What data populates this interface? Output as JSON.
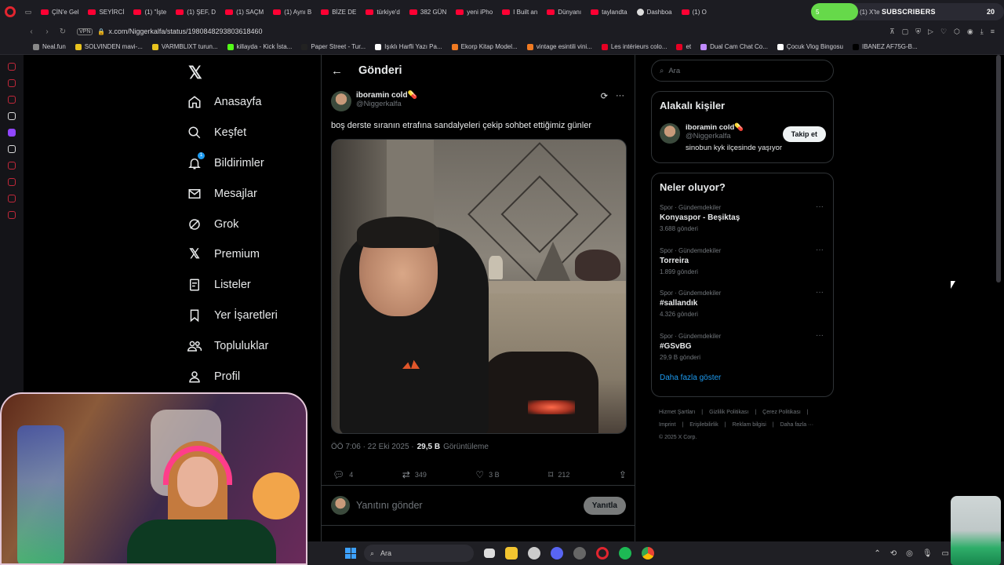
{
  "browser": {
    "tabs": [
      {
        "label": "ÇİN'e Gel"
      },
      {
        "label": "SEYİRCİ"
      },
      {
        "label": "(1) \"İşte"
      },
      {
        "label": "(1) ŞEF, D"
      },
      {
        "label": "(1) SAÇM"
      },
      {
        "label": "(1) Aynı B"
      },
      {
        "label": "BİZE DE"
      },
      {
        "label": "türkiye'd"
      },
      {
        "label": "382 GÜN"
      },
      {
        "label": "yeni iPho"
      },
      {
        "label": "I Built an"
      },
      {
        "label": "Dünyanı"
      },
      {
        "label": "taylandta"
      },
      {
        "label": "Dashboa"
      },
      {
        "label": "(1) O"
      }
    ],
    "subscriber_widget": {
      "label": "SUBSCRIBERS",
      "count": "20",
      "badge": "5",
      "extra_tab": "(1) X'te"
    },
    "url": "x.com/Niggerkalfa/status/1980848293803618460",
    "vpn_label": "VPN",
    "bookmarks": [
      "Neal.fun",
      "SOLVINDEN mavi-...",
      "VARMBLIXT turun...",
      "killayda - Kick İsta...",
      "Paper Street - Tur...",
      "Işıklı Harfli Yazı Pa...",
      "Ekorp Kitap Model...",
      "vintage esintili vini...",
      "Les intérieurs colo...",
      "et",
      "Dual Cam Chat Co...",
      "Çocuk Vlog Bingosu",
      "IBANEZ AF75G-B..."
    ]
  },
  "nav": {
    "items": [
      {
        "label": "Anasayfa",
        "icon": "home-icon"
      },
      {
        "label": "Keşfet",
        "icon": "search-icon"
      },
      {
        "label": "Bildirimler",
        "icon": "bell-icon",
        "badge": "1"
      },
      {
        "label": "Mesajlar",
        "icon": "mail-icon"
      },
      {
        "label": "Grok",
        "icon": "grok-icon"
      },
      {
        "label": "Premium",
        "icon": "x-icon"
      },
      {
        "label": "Listeler",
        "icon": "list-icon"
      },
      {
        "label": "Yer İşaretleri",
        "icon": "bookmark-icon"
      },
      {
        "label": "Topluluklar",
        "icon": "communities-icon"
      },
      {
        "label": "Profil",
        "icon": "person-icon"
      }
    ]
  },
  "main": {
    "title": "Gönderi",
    "post": {
      "name": "iboramin cold💊",
      "handle": "@Niggerkalfa",
      "text": "boş derste sıranın etrafına sandalyeleri çekip sohbet ettiğimiz günler",
      "timestamp": "ÖÖ 7:06 · 22 Eki 2025 ·",
      "views_count": "29,5 B",
      "views_label": "Görüntüleme",
      "replies": "4",
      "reposts": "349",
      "likes": "3 B",
      "bookmarks": "212"
    },
    "reply": {
      "placeholder": "Yanıtını gönder",
      "button": "Yanıtla"
    }
  },
  "right": {
    "search_placeholder": "Ara",
    "related": {
      "title": "Alakalı kişiler",
      "name": "iboramin cold💊",
      "handle": "@Niggerkalfa",
      "bio": "sinobun kyk ilçesinde yaşıyor",
      "follow": "Takip et"
    },
    "trends": {
      "title": "Neler oluyor?",
      "items": [
        {
          "category": "Spor · Gündemdekiler",
          "title": "Konyaspor - Beşiktaş",
          "count": "3.688 gönderi"
        },
        {
          "category": "Spor · Gündemdekiler",
          "title": "Torreira",
          "count": "1.899 gönderi"
        },
        {
          "category": "Spor · Gündemdekiler",
          "title": "#sallandık",
          "count": "4.326 gönderi"
        },
        {
          "category": "Spor · Gündemdekiler",
          "title": "#GSvBG",
          "count": "29,9 B gönderi"
        }
      ],
      "show_more": "Daha fazla göster"
    },
    "footer": [
      "Hizmet Şartları",
      "|",
      "Gizlilik Politikası",
      "|",
      "Çerez Politikası",
      "|",
      "Imprint",
      "|",
      "Erişilebilirlik",
      "|",
      "Reklam bilgisi",
      "|",
      "Daha fazla ···",
      "© 2025 X Corp."
    ]
  },
  "taskbar": {
    "search_placeholder": "Ara"
  }
}
